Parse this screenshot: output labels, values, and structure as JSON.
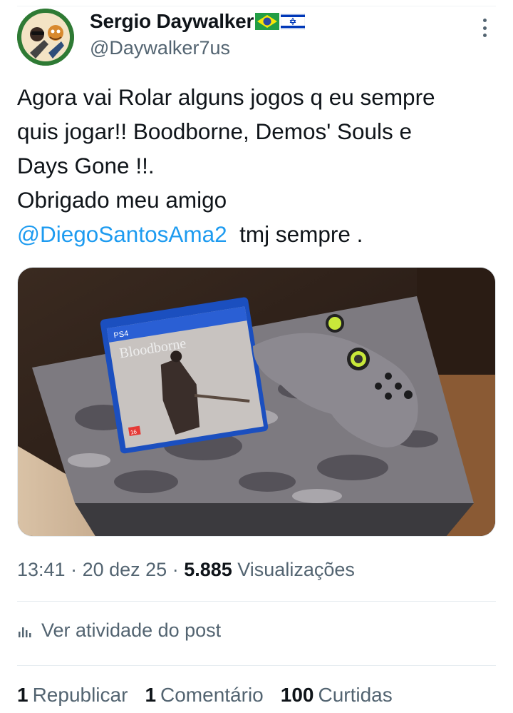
{
  "author": {
    "display_name": "Sergio Daywalker",
    "handle": "@Daywalker7us",
    "flags": [
      "brazil-flag-icon",
      "israel-flag-icon"
    ]
  },
  "tweet": {
    "line1": "Agora vai Rolar alguns jogos q eu sempre",
    "line2": "quis jogar!! Boodborne, Demos' Souls e",
    "line3": "Days Gone !!.",
    "line4": "Obrigado meu amigo",
    "mention": "@DiegoSantosAma2",
    "tail": "  tmj sempre ."
  },
  "media": {
    "game_cover_title": "Bloodborne",
    "platform": "PS4",
    "age_rating": "16"
  },
  "meta": {
    "time": "13:41",
    "sep1": " · ",
    "date": "20 dez 25",
    "sep2": " · ",
    "views_count": "5.885",
    "views_label": " Visualizações"
  },
  "activity": {
    "label": "Ver atividade do post"
  },
  "stats": {
    "reposts_count": "1",
    "reposts_label": "Republicar",
    "comments_count": "1",
    "comments_label": "Comentário",
    "likes_count": "100",
    "likes_label": "Curtidas"
  },
  "colors": {
    "link": "#1d9bf0",
    "secondary_text": "#536471",
    "primary_text": "#0f1419"
  }
}
